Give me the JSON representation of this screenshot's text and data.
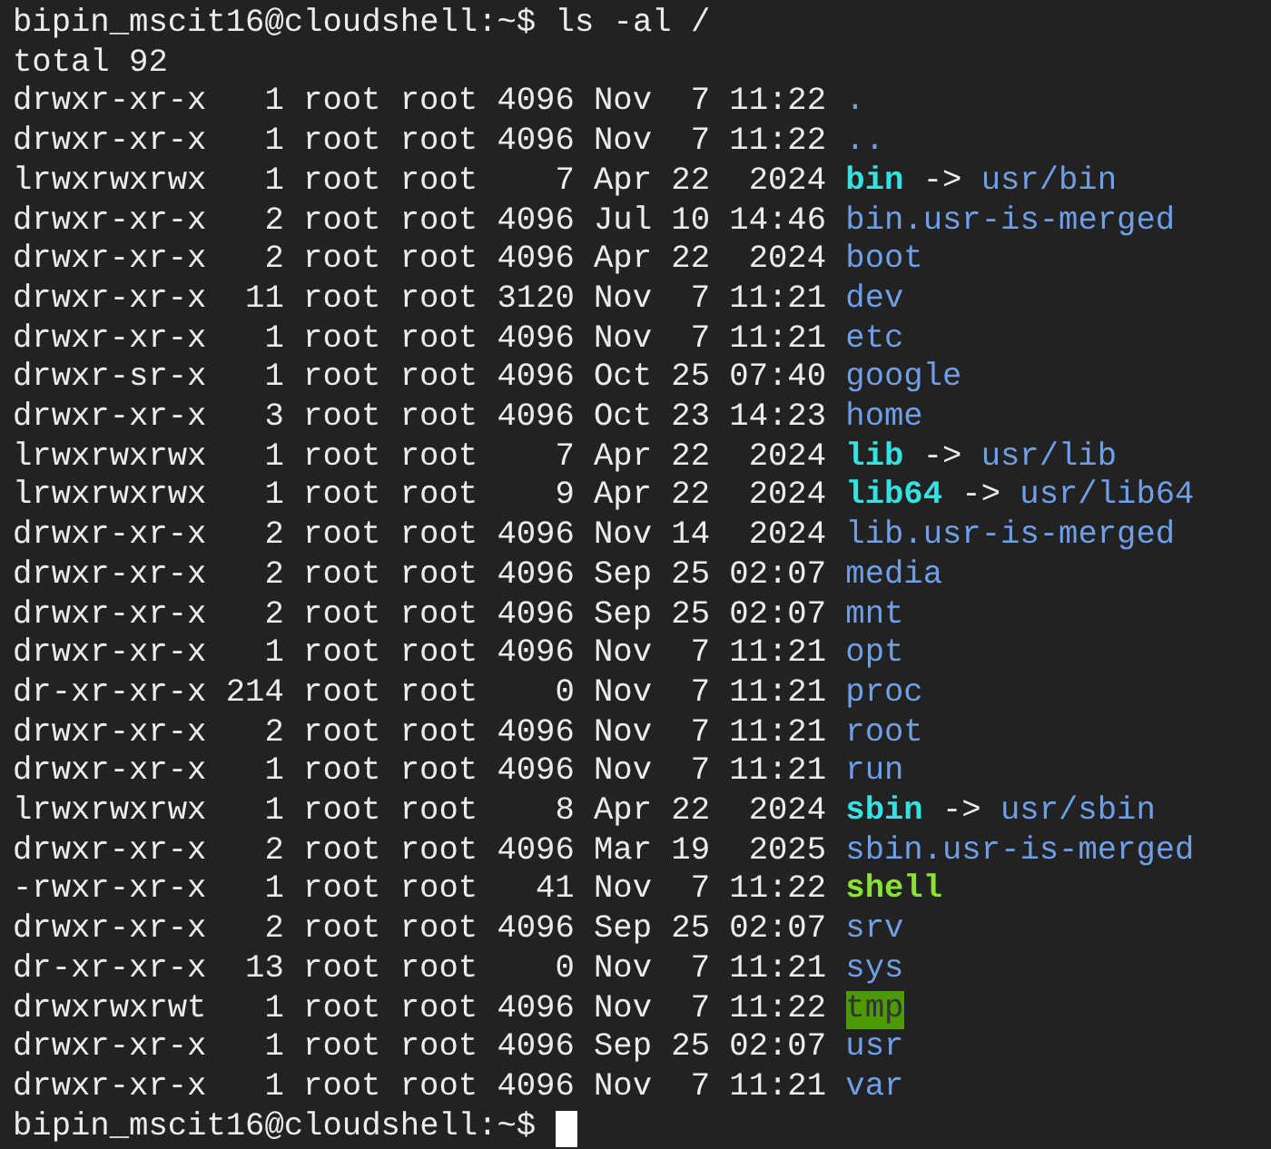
{
  "command_line": {
    "prompt": "bipin_mscit16@cloudshell:~$",
    "command": "ls -al /"
  },
  "total": "total 92",
  "entries": [
    {
      "perms": "drwxr-xr-x",
      "links": "1",
      "owner": "root",
      "group": "root",
      "size": "4096",
      "month": "Nov",
      "day": "7",
      "time": "11:22",
      "name": ".",
      "kind": "dir"
    },
    {
      "perms": "drwxr-xr-x",
      "links": "1",
      "owner": "root",
      "group": "root",
      "size": "4096",
      "month": "Nov",
      "day": "7",
      "time": "11:22",
      "name": "..",
      "kind": "dir"
    },
    {
      "perms": "lrwxrwxrwx",
      "links": "1",
      "owner": "root",
      "group": "root",
      "size": "7",
      "month": "Apr",
      "day": "22",
      "time": "2024",
      "name": "bin",
      "kind": "link",
      "arrow": "->",
      "target": "usr/bin"
    },
    {
      "perms": "drwxr-xr-x",
      "links": "2",
      "owner": "root",
      "group": "root",
      "size": "4096",
      "month": "Jul",
      "day": "10",
      "time": "14:46",
      "name": "bin.usr-is-merged",
      "kind": "dir"
    },
    {
      "perms": "drwxr-xr-x",
      "links": "2",
      "owner": "root",
      "group": "root",
      "size": "4096",
      "month": "Apr",
      "day": "22",
      "time": "2024",
      "name": "boot",
      "kind": "dir"
    },
    {
      "perms": "drwxr-xr-x",
      "links": "11",
      "owner": "root",
      "group": "root",
      "size": "3120",
      "month": "Nov",
      "day": "7",
      "time": "11:21",
      "name": "dev",
      "kind": "dir"
    },
    {
      "perms": "drwxr-xr-x",
      "links": "1",
      "owner": "root",
      "group": "root",
      "size": "4096",
      "month": "Nov",
      "day": "7",
      "time": "11:21",
      "name": "etc",
      "kind": "dir"
    },
    {
      "perms": "drwxr-sr-x",
      "links": "1",
      "owner": "root",
      "group": "root",
      "size": "4096",
      "month": "Oct",
      "day": "25",
      "time": "07:40",
      "name": "google",
      "kind": "dir"
    },
    {
      "perms": "drwxr-xr-x",
      "links": "3",
      "owner": "root",
      "group": "root",
      "size": "4096",
      "month": "Oct",
      "day": "23",
      "time": "14:23",
      "name": "home",
      "kind": "dir"
    },
    {
      "perms": "lrwxrwxrwx",
      "links": "1",
      "owner": "root",
      "group": "root",
      "size": "7",
      "month": "Apr",
      "day": "22",
      "time": "2024",
      "name": "lib",
      "kind": "link",
      "arrow": "->",
      "target": "usr/lib"
    },
    {
      "perms": "lrwxrwxrwx",
      "links": "1",
      "owner": "root",
      "group": "root",
      "size": "9",
      "month": "Apr",
      "day": "22",
      "time": "2024",
      "name": "lib64",
      "kind": "link",
      "arrow": "->",
      "target": "usr/lib64"
    },
    {
      "perms": "drwxr-xr-x",
      "links": "2",
      "owner": "root",
      "group": "root",
      "size": "4096",
      "month": "Nov",
      "day": "14",
      "time": "2024",
      "name": "lib.usr-is-merged",
      "kind": "dir"
    },
    {
      "perms": "drwxr-xr-x",
      "links": "2",
      "owner": "root",
      "group": "root",
      "size": "4096",
      "month": "Sep",
      "day": "25",
      "time": "02:07",
      "name": "media",
      "kind": "dir"
    },
    {
      "perms": "drwxr-xr-x",
      "links": "2",
      "owner": "root",
      "group": "root",
      "size": "4096",
      "month": "Sep",
      "day": "25",
      "time": "02:07",
      "name": "mnt",
      "kind": "dir"
    },
    {
      "perms": "drwxr-xr-x",
      "links": "1",
      "owner": "root",
      "group": "root",
      "size": "4096",
      "month": "Nov",
      "day": "7",
      "time": "11:21",
      "name": "opt",
      "kind": "dir"
    },
    {
      "perms": "dr-xr-xr-x",
      "links": "214",
      "owner": "root",
      "group": "root",
      "size": "0",
      "month": "Nov",
      "day": "7",
      "time": "11:21",
      "name": "proc",
      "kind": "dir"
    },
    {
      "perms": "drwxr-xr-x",
      "links": "2",
      "owner": "root",
      "group": "root",
      "size": "4096",
      "month": "Nov",
      "day": "7",
      "time": "11:21",
      "name": "root",
      "kind": "dir"
    },
    {
      "perms": "drwxr-xr-x",
      "links": "1",
      "owner": "root",
      "group": "root",
      "size": "4096",
      "month": "Nov",
      "day": "7",
      "time": "11:21",
      "name": "run",
      "kind": "dir"
    },
    {
      "perms": "lrwxrwxrwx",
      "links": "1",
      "owner": "root",
      "group": "root",
      "size": "8",
      "month": "Apr",
      "day": "22",
      "time": "2024",
      "name": "sbin",
      "kind": "link",
      "arrow": "->",
      "target": "usr/sbin"
    },
    {
      "perms": "drwxr-xr-x",
      "links": "2",
      "owner": "root",
      "group": "root",
      "size": "4096",
      "month": "Mar",
      "day": "19",
      "time": "2025",
      "name": "sbin.usr-is-merged",
      "kind": "dir"
    },
    {
      "perms": "-rwxr-xr-x",
      "links": "1",
      "owner": "root",
      "group": "root",
      "size": "41",
      "month": "Nov",
      "day": "7",
      "time": "11:22",
      "name": "shell",
      "kind": "exec"
    },
    {
      "perms": "drwxr-xr-x",
      "links": "2",
      "owner": "root",
      "group": "root",
      "size": "4096",
      "month": "Sep",
      "day": "25",
      "time": "02:07",
      "name": "srv",
      "kind": "dir"
    },
    {
      "perms": "dr-xr-xr-x",
      "links": "13",
      "owner": "root",
      "group": "root",
      "size": "0",
      "month": "Nov",
      "day": "7",
      "time": "11:21",
      "name": "sys",
      "kind": "dir"
    },
    {
      "perms": "drwxrwxrwt",
      "links": "1",
      "owner": "root",
      "group": "root",
      "size": "4096",
      "month": "Nov",
      "day": "7",
      "time": "11:22",
      "name": "tmp",
      "kind": "sticky"
    },
    {
      "perms": "drwxr-xr-x",
      "links": "1",
      "owner": "root",
      "group": "root",
      "size": "4096",
      "month": "Sep",
      "day": "25",
      "time": "02:07",
      "name": "usr",
      "kind": "dir"
    },
    {
      "perms": "drwxr-xr-x",
      "links": "1",
      "owner": "root",
      "group": "root",
      "size": "4096",
      "month": "Nov",
      "day": "7",
      "time": "11:21",
      "name": "var",
      "kind": "dir"
    }
  ],
  "final_prompt": {
    "prompt": "bipin_mscit16@cloudshell:~$"
  }
}
